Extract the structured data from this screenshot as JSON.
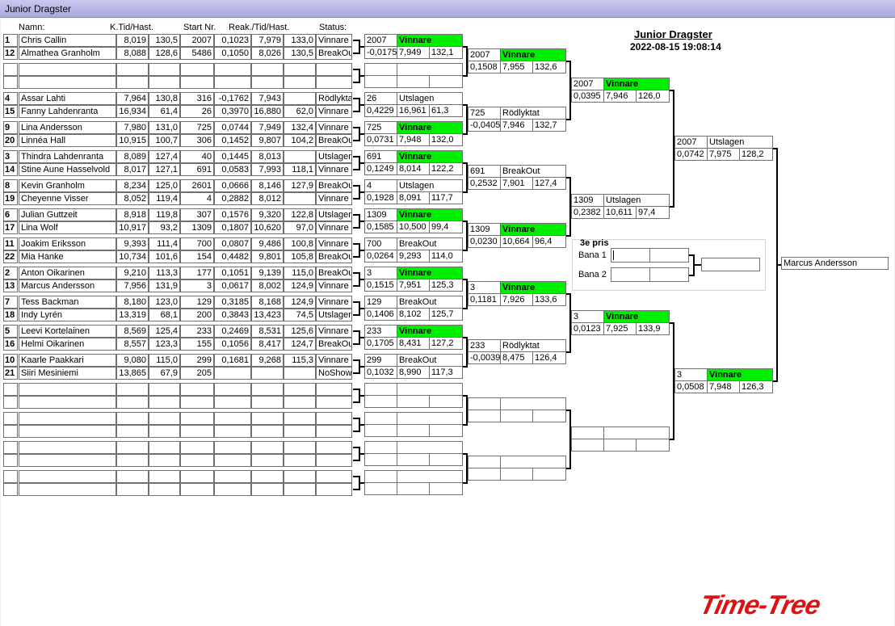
{
  "window": {
    "title": "Junior Dragster"
  },
  "event": {
    "title": "Junior Dragster",
    "datetime": "2022-08-15 19:08:14"
  },
  "headers": {
    "name": "Namn:",
    "ktid": "K.Tid/Hast.",
    "startnr": "Start Nr.",
    "reak": "Reak./Tid/Hast.",
    "status": "Status:"
  },
  "entries": [
    {
      "seed": "1",
      "name": "Chris Callin",
      "ktid": "8,019",
      "khast": "130,5",
      "start": "2007",
      "reak": "0,1023",
      "tid": "7,979",
      "hast": "133,0",
      "status": "Vinnare"
    },
    {
      "seed": "12",
      "name": "Almathea Granholm",
      "ktid": "8,088",
      "khast": "128,6",
      "start": "5486",
      "reak": "0,1050",
      "tid": "8,026",
      "hast": "130,5",
      "status": "BreakOut"
    },
    {
      "seed": "",
      "name": "",
      "ktid": "",
      "khast": "",
      "start": "",
      "reak": "",
      "tid": "",
      "hast": "",
      "status": ""
    },
    {
      "seed": "",
      "name": "",
      "ktid": "",
      "khast": "",
      "start": "",
      "reak": "",
      "tid": "",
      "hast": "",
      "status": ""
    },
    {
      "seed": "4",
      "name": "Assar Lahti",
      "ktid": "7,964",
      "khast": "130,8",
      "start": "316",
      "reak": "-0,1762",
      "tid": "7,943",
      "hast": "",
      "status": "Rödlyktat"
    },
    {
      "seed": "15",
      "name": "Fanny Lahdenranta",
      "ktid": "16,934",
      "khast": "61,4",
      "start": "26",
      "reak": "0,3970",
      "tid": "16,880",
      "hast": "62,0",
      "status": "Vinnare"
    },
    {
      "seed": "9",
      "name": "Lina Andersson",
      "ktid": "7,980",
      "khast": "131,0",
      "start": "725",
      "reak": "0,0744",
      "tid": "7,949",
      "hast": "132,4",
      "status": "Vinnare"
    },
    {
      "seed": "20",
      "name": "Linnéa Hall",
      "ktid": "10,915",
      "khast": "100,7",
      "start": "306",
      "reak": "0,1452",
      "tid": "9,807",
      "hast": "104,2",
      "status": "BreakOut"
    },
    {
      "seed": "3",
      "name": "Thindra Lahdenranta",
      "ktid": "8,089",
      "khast": "127,4",
      "start": "40",
      "reak": "0,1445",
      "tid": "8,013",
      "hast": "",
      "status": "Utslagen"
    },
    {
      "seed": "14",
      "name": "Stine Aune Hasselvold",
      "ktid": "8,017",
      "khast": "127,1",
      "start": "691",
      "reak": "0,0583",
      "tid": "7,993",
      "hast": "118,1",
      "status": "Vinnare"
    },
    {
      "seed": "8",
      "name": "Kevin Granholm",
      "ktid": "8,234",
      "khast": "125,0",
      "start": "2601",
      "reak": "0,0666",
      "tid": "8,146",
      "hast": "127,9",
      "status": "BreakOut"
    },
    {
      "seed": "19",
      "name": "Cheyenne  Visser",
      "ktid": "8,052",
      "khast": "119,4",
      "start": "4",
      "reak": "0,2882",
      "tid": "8,012",
      "hast": "",
      "status": "Vinnare"
    },
    {
      "seed": "6",
      "name": "Julian  Guttzeit",
      "ktid": "8,918",
      "khast": "119,8",
      "start": "307",
      "reak": "0,1576",
      "tid": "9,320",
      "hast": "122,8",
      "status": "Utslagen"
    },
    {
      "seed": "17",
      "name": "Lina  Wolf",
      "ktid": "10,917",
      "khast": "93,2",
      "start": "1309",
      "reak": "0,1807",
      "tid": "10,620",
      "hast": "97,0",
      "status": "Vinnare"
    },
    {
      "seed": "11",
      "name": "Joakim Eriksson",
      "ktid": "9,393",
      "khast": "111,4",
      "start": "700",
      "reak": "0,0807",
      "tid": "9,486",
      "hast": "100,8",
      "status": "Vinnare"
    },
    {
      "seed": "22",
      "name": "Mia Hanke",
      "ktid": "10,734",
      "khast": "101,6",
      "start": "154",
      "reak": "0,4482",
      "tid": "9,801",
      "hast": "105,8",
      "status": "BreakOut"
    },
    {
      "seed": "2",
      "name": "Anton Oikarinen",
      "ktid": "9,210",
      "khast": "113,3",
      "start": "177",
      "reak": "0,1051",
      "tid": "9,139",
      "hast": "115,0",
      "status": "BreakOut"
    },
    {
      "seed": "13",
      "name": "Marcus Andersson",
      "ktid": "7,956",
      "khast": "131,9",
      "start": "3",
      "reak": "0,0617",
      "tid": "8,002",
      "hast": "124,9",
      "status": "Vinnare"
    },
    {
      "seed": "7",
      "name": "Tess Backman",
      "ktid": "8,180",
      "khast": "123,0",
      "start": "129",
      "reak": "0,3185",
      "tid": "8,168",
      "hast": "124,9",
      "status": "Vinnare"
    },
    {
      "seed": "18",
      "name": "Indy Lyrén",
      "ktid": "13,319",
      "khast": "68,1",
      "start": "200",
      "reak": "0,3843",
      "tid": "13,423",
      "hast": "74,5",
      "status": "Utslagen"
    },
    {
      "seed": "5",
      "name": "Leevi Kortelainen",
      "ktid": "8,569",
      "khast": "125,4",
      "start": "233",
      "reak": "0,2469",
      "tid": "8,531",
      "hast": "125,6",
      "status": "Vinnare"
    },
    {
      "seed": "16",
      "name": "Helmi Oikarinen",
      "ktid": "8,557",
      "khast": "123,3",
      "start": "155",
      "reak": "0,1056",
      "tid": "8,417",
      "hast": "124,7",
      "status": "BreakOut"
    },
    {
      "seed": "10",
      "name": "Kaarle Paakkari",
      "ktid": "9,080",
      "khast": "115,0",
      "start": "299",
      "reak": "0,1681",
      "tid": "9,268",
      "hast": "115,3",
      "status": "Vinnare"
    },
    {
      "seed": "21",
      "name": "Siiri Mesiniemi",
      "ktid": "13,865",
      "khast": "67,9",
      "start": "205",
      "reak": "",
      "tid": "",
      "hast": "",
      "status": "NoShow"
    },
    {
      "seed": "",
      "name": "",
      "ktid": "",
      "khast": "",
      "start": "",
      "reak": "",
      "tid": "",
      "hast": "",
      "status": ""
    },
    {
      "seed": "",
      "name": "",
      "ktid": "",
      "khast": "",
      "start": "",
      "reak": "",
      "tid": "",
      "hast": "",
      "status": ""
    },
    {
      "seed": "",
      "name": "",
      "ktid": "",
      "khast": "",
      "start": "",
      "reak": "",
      "tid": "",
      "hast": "",
      "status": ""
    },
    {
      "seed": "",
      "name": "",
      "ktid": "",
      "khast": "",
      "start": "",
      "reak": "",
      "tid": "",
      "hast": "",
      "status": ""
    },
    {
      "seed": "",
      "name": "",
      "ktid": "",
      "khast": "",
      "start": "",
      "reak": "",
      "tid": "",
      "hast": "",
      "status": ""
    },
    {
      "seed": "",
      "name": "",
      "ktid": "",
      "khast": "",
      "start": "",
      "reak": "",
      "tid": "",
      "hast": "",
      "status": ""
    },
    {
      "seed": "",
      "name": "",
      "ktid": "",
      "khast": "",
      "start": "",
      "reak": "",
      "tid": "",
      "hast": "",
      "status": ""
    },
    {
      "seed": "",
      "name": "",
      "ktid": "",
      "khast": "",
      "start": "",
      "reak": "",
      "tid": "",
      "hast": "",
      "status": ""
    }
  ],
  "rounds": [
    [
      {
        "nr": "2007",
        "status": "Vinnare",
        "reak": "-0,0175",
        "tid": "7,949",
        "hast": "132,1",
        "winner": true
      },
      {
        "nr": "",
        "status": "",
        "reak": "",
        "tid": "",
        "hast": "",
        "winner": false
      },
      {
        "nr": "26",
        "status": "Utslagen",
        "reak": "0,4229",
        "tid": "16,961",
        "hast": "61,3",
        "winner": false
      },
      {
        "nr": "725",
        "status": "Vinnare",
        "reak": "0,0731",
        "tid": "7,948",
        "hast": "132,0",
        "winner": true
      },
      {
        "nr": "691",
        "status": "Vinnare",
        "reak": "0,1249",
        "tid": "8,014",
        "hast": "122,2",
        "winner": true
      },
      {
        "nr": "4",
        "status": "Utslagen",
        "reak": "0,1928",
        "tid": "8,091",
        "hast": "117,7",
        "winner": false
      },
      {
        "nr": "1309",
        "status": "Vinnare",
        "reak": "0,1585",
        "tid": "10,500",
        "hast": "99,4",
        "winner": true
      },
      {
        "nr": "700",
        "status": "BreakOut",
        "reak": "0,0264",
        "tid": "9,293",
        "hast": "114,0",
        "winner": false
      },
      {
        "nr": "3",
        "status": "Vinnare",
        "reak": "0,1515",
        "tid": "7,951",
        "hast": "125,3",
        "winner": true
      },
      {
        "nr": "129",
        "status": "BreakOut",
        "reak": "0,1406",
        "tid": "8,102",
        "hast": "125,7",
        "winner": false
      },
      {
        "nr": "233",
        "status": "Vinnare",
        "reak": "0,1705",
        "tid": "8,431",
        "hast": "127,2",
        "winner": true
      },
      {
        "nr": "299",
        "status": "BreakOut",
        "reak": "0,1032",
        "tid": "8,990",
        "hast": "117,3",
        "winner": false
      },
      {
        "nr": "",
        "status": "",
        "reak": "",
        "tid": "",
        "hast": "",
        "winner": false
      },
      {
        "nr": "",
        "status": "",
        "reak": "",
        "tid": "",
        "hast": "",
        "winner": false
      },
      {
        "nr": "",
        "status": "",
        "reak": "",
        "tid": "",
        "hast": "",
        "winner": false
      },
      {
        "nr": "",
        "status": "",
        "reak": "",
        "tid": "",
        "hast": "",
        "winner": false
      }
    ],
    [
      {
        "nr": "2007",
        "status": "Vinnare",
        "reak": "0,1508",
        "tid": "7,955",
        "hast": "132,6",
        "winner": true
      },
      {
        "nr": "725",
        "status": "Rödlyktat",
        "reak": "-0,0405",
        "tid": "7,946",
        "hast": "132,7",
        "winner": false
      },
      {
        "nr": "691",
        "status": "BreakOut",
        "reak": "0,2532",
        "tid": "7,901",
        "hast": "127,4",
        "winner": false
      },
      {
        "nr": "1309",
        "status": "Vinnare",
        "reak": "0,0230",
        "tid": "10,664",
        "hast": "96,4",
        "winner": true
      },
      {
        "nr": "3",
        "status": "Vinnare",
        "reak": "0,1181",
        "tid": "7,926",
        "hast": "133,6",
        "winner": true
      },
      {
        "nr": "233",
        "status": "Rödlyktat",
        "reak": "-0,0039",
        "tid": "8,475",
        "hast": "126,4",
        "winner": false
      },
      {
        "nr": "",
        "status": "",
        "reak": "",
        "tid": "",
        "hast": "",
        "winner": false
      },
      {
        "nr": "",
        "status": "",
        "reak": "",
        "tid": "",
        "hast": "",
        "winner": false
      }
    ],
    [
      {
        "nr": "2007",
        "status": "Vinnare",
        "reak": "0,0395",
        "tid": "7,946",
        "hast": "126,0",
        "winner": true
      },
      {
        "nr": "1309",
        "status": "Utslagen",
        "reak": "0,2382",
        "tid": "10,611",
        "hast": "97,4",
        "winner": false
      },
      {
        "nr": "3",
        "status": "Vinnare",
        "reak": "0,0123",
        "tid": "7,925",
        "hast": "133,9",
        "winner": true
      },
      {
        "nr": "",
        "status": "",
        "reak": "",
        "tid": "",
        "hast": "",
        "winner": false
      }
    ],
    [
      {
        "nr": "2007",
        "status": "Utslagen",
        "reak": "0,0742",
        "tid": "7,975",
        "hast": "128,2",
        "winner": false
      },
      {
        "nr": "3",
        "status": "Vinnare",
        "reak": "0,0508",
        "tid": "7,948",
        "hast": "126,3",
        "winner": true
      }
    ]
  ],
  "champion": "Marcus Andersson",
  "third_place": {
    "title": "3e pris",
    "lane1": "Bana 1",
    "lane2": "Bana 2"
  },
  "logo": "Time-Tree"
}
